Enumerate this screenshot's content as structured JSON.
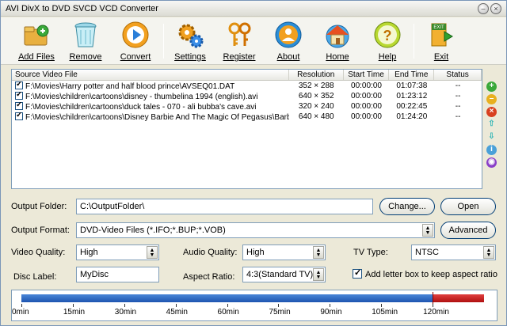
{
  "window": {
    "title": "AVI DivX to DVD SVCD VCD Converter"
  },
  "toolbar": [
    {
      "id": "add-files",
      "label": "Add Files",
      "icon": "folder-plus-icon"
    },
    {
      "id": "remove",
      "label": "Remove",
      "icon": "trash-icon"
    },
    {
      "id": "convert",
      "label": "Convert",
      "icon": "play-icon"
    },
    {
      "id": "settings",
      "label": "Settings",
      "icon": "gears-icon"
    },
    {
      "id": "register",
      "label": "Register",
      "icon": "keys-icon"
    },
    {
      "id": "about",
      "label": "About",
      "icon": "person-icon"
    },
    {
      "id": "home",
      "label": "Home",
      "icon": "home-icon"
    },
    {
      "id": "help",
      "label": "Help",
      "icon": "question-icon"
    },
    {
      "id": "exit",
      "label": "Exit",
      "icon": "exit-door-icon"
    }
  ],
  "list": {
    "headers": [
      "Source Video File",
      "Resolution",
      "Start Time",
      "End Time",
      "Status"
    ],
    "rows": [
      {
        "file": "F:\\Movies\\Harry potter and half blood prince\\AVSEQ01.DAT",
        "resolution": "352 × 288",
        "start": "00:00:00",
        "end": "01:07:38",
        "status": "--"
      },
      {
        "file": "F:\\Movies\\children\\cartoons\\disney - thumbelina 1994 (english).avi",
        "resolution": "640 × 352",
        "start": "00:00:00",
        "end": "01:23:12",
        "status": "--"
      },
      {
        "file": "F:\\Movies\\children\\cartoons\\duck tales - 070 - ali bubba's cave.avi",
        "resolution": "320 × 240",
        "start": "00:00:00",
        "end": "00:22:45",
        "status": "--"
      },
      {
        "file": "F:\\Movies\\children\\cartoons\\Disney Barbie And The Magic Of Pegasus\\Barbie And...",
        "resolution": "640 × 480",
        "start": "00:00:00",
        "end": "01:24:20",
        "status": "--"
      }
    ]
  },
  "output_folder": {
    "label": "Output Folder:",
    "value": "C:\\OutputFolder\\",
    "change_label": "Change...",
    "open_label": "Open"
  },
  "output_format": {
    "label": "Output Format:",
    "value": "DVD-Video Files  (*.IFO;*.BUP;*.VOB)",
    "advanced_label": "Advanced"
  },
  "video_quality": {
    "label": "Video Quality:",
    "value": "High"
  },
  "audio_quality": {
    "label": "Audio Quality:",
    "value": "High"
  },
  "tv_type": {
    "label": "TV Type:",
    "value": "NTSC"
  },
  "disc_label": {
    "label": "Disc Label:",
    "value": "MyDisc"
  },
  "aspect_ratio": {
    "label": "Aspect Ratio:",
    "value": "4:3(Standard TV)"
  },
  "letterbox": {
    "label": "Add letter box to keep aspect ratio",
    "checked": true
  },
  "timeline": {
    "ticks": [
      "0min",
      "15min",
      "30min",
      "45min",
      "60min",
      "75min",
      "90min",
      "105min",
      "120min"
    ],
    "max_minutes": 135,
    "capacity_minutes": 120,
    "used_minutes": 137.9
  },
  "colors": {
    "bar_blue": "#1e55b0",
    "bar_red": "#c41818",
    "accent_border": "#7f9db9"
  }
}
